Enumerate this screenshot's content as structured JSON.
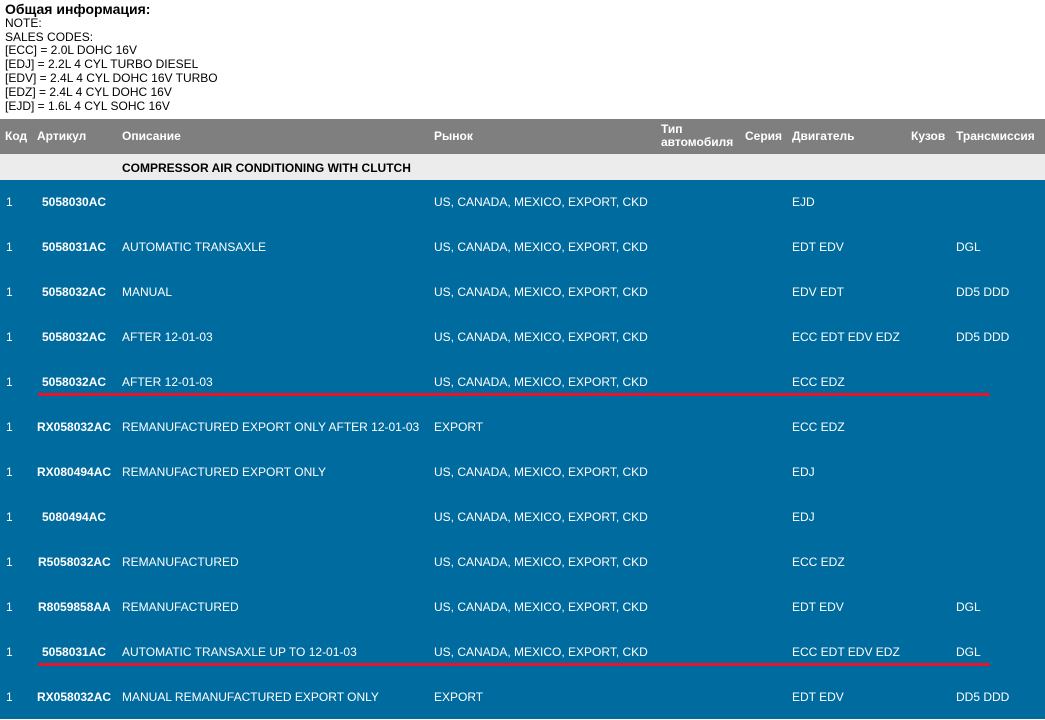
{
  "info": {
    "title": "Общая информация:",
    "lines": [
      "NOTE:",
      "SALES CODES:",
      "[ECC] = 2.0L DOHC 16V",
      "[EDJ] = 2.2L 4 CYL TURBO DIESEL",
      "[EDV] = 2.4L 4 CYL DOHC 16V TURBO",
      "[EDZ] = 2.4L 4 CYL DOHC 16V",
      "[EJD] = 1.6L 4 CYL SOHC 16V"
    ]
  },
  "table": {
    "headers": {
      "code": "Код",
      "article": "Артикул",
      "description": "Описание",
      "market": "Рынок",
      "type_line1": "Тип",
      "type_line2": "автомобиля",
      "series": "Серия",
      "engine": "Двигатель",
      "body": "Кузов",
      "transmission": "Трансмиссия"
    },
    "section": "COMPRESSOR AIR CONDITIONING WITH CLUTCH",
    "rows": [
      {
        "code": "1",
        "article": "5058030AC",
        "description": "",
        "market": "US, CANADA, MEXICO, EXPORT, CKD",
        "engine": "EJD",
        "transmission": ""
      },
      {
        "code": "1",
        "article": "5058031AC",
        "description": "AUTOMATIC TRANSAXLE",
        "market": "US, CANADA, MEXICO, EXPORT, CKD",
        "engine": "EDT EDV",
        "transmission": "DGL"
      },
      {
        "code": "1",
        "article": "5058032AC",
        "description": "MANUAL",
        "market": "US, CANADA, MEXICO, EXPORT, CKD",
        "engine": "EDV EDT",
        "transmission": "DD5 DDD"
      },
      {
        "code": "1",
        "article": "5058032AC",
        "description": "AFTER 12-01-03",
        "market": "US, CANADA, MEXICO, EXPORT, CKD",
        "engine": "ECC EDT EDV EDZ",
        "transmission": "DD5 DDD"
      },
      {
        "code": "1",
        "article": "5058032AC",
        "description": "AFTER 12-01-03",
        "market": "US, CANADA, MEXICO, EXPORT, CKD",
        "engine": "ECC EDZ",
        "transmission": ""
      },
      {
        "code": "1",
        "article": "RX058032AC",
        "description": "REMANUFACTURED EXPORT ONLY AFTER 12-01-03",
        "market": "EXPORT",
        "engine": "ECC EDZ",
        "transmission": ""
      },
      {
        "code": "1",
        "article": "RX080494AC",
        "description": "REMANUFACTURED EXPORT ONLY",
        "market": "US, CANADA, MEXICO, EXPORT, CKD",
        "engine": "EDJ",
        "transmission": ""
      },
      {
        "code": "1",
        "article": "5080494AC",
        "description": "",
        "market": "US, CANADA, MEXICO, EXPORT, CKD",
        "engine": "EDJ",
        "transmission": ""
      },
      {
        "code": "1",
        "article": "R5058032AC",
        "description": "REMANUFACTURED",
        "market": "US, CANADA, MEXICO, EXPORT, CKD",
        "engine": "ECC EDZ",
        "transmission": ""
      },
      {
        "code": "1",
        "article": "R8059858AA",
        "description": "REMANUFACTURED",
        "market": "US, CANADA, MEXICO, EXPORT, CKD",
        "engine": "EDT EDV",
        "transmission": "DGL"
      },
      {
        "code": "1",
        "article": "5058031AC",
        "description": "AUTOMATIC TRANSAXLE UP TO 12-01-03",
        "market": "US, CANADA, MEXICO, EXPORT, CKD",
        "engine": "ECC EDT EDV EDZ",
        "transmission": "DGL"
      },
      {
        "code": "1",
        "article": "RX058032AC",
        "description": "MANUAL REMANUFACTURED EXPORT ONLY",
        "market": "EXPORT",
        "engine": "EDT EDV",
        "transmission": "DD5 DDD"
      }
    ],
    "highlighted_rows": [
      4,
      10
    ]
  },
  "colors": {
    "header_bg": "#7f7f7f",
    "section_bg": "#ececec",
    "body_bg": "#006b9f",
    "highlight": "#e8142a"
  }
}
